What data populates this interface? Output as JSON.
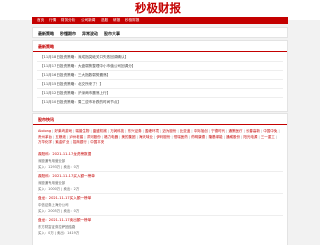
{
  "site": {
    "logo": "秒极财报"
  },
  "nav": {
    "items": [
      "首页",
      "行情",
      "财务分析",
      "公司新闻",
      "选股",
      "研报",
      "秒极财报"
    ]
  },
  "tabs": [
    "最新策略",
    "秒懂期市",
    "异常波动",
    "股市大事"
  ],
  "section2": {
    "title": "最新策略",
    "items": [
      "【11月18日投资策略：深成指突破关口失败回调确认】",
      "【11月17日投资策略：大盘弱势整理中小市值公司回调分】",
      "【11月16日投资策略：三大指数弱势震荡】",
      "【11月15日投资策略：北交所来了！】",
      "【11月12日投资策略：沪深两市震荡上行】",
      "【11月10日投资策略：周二逆市补跌的时间节点】"
    ]
  },
  "section3": {
    "title": "股市快讯",
    "stocks": [
      "Aiolong",
      "好莱坞游戏",
      "瑞普生物",
      "晶盛机械",
      "万润科技",
      "东兴证券",
      "盈峰环境",
      "迈为股份",
      "比亚迪",
      "中际旭创",
      "宁德时代",
      "通策医疗",
      "长春高新",
      "中国中免",
      "贵州茅台",
      "五粮液",
      "泸州老窖",
      "洋河股份",
      "格力电器",
      "美的集团",
      "海天味业",
      "伊利股份",
      "恒瑞医药",
      "药明康德",
      "隆基绿能",
      "通威股份",
      "阳光电源",
      "三一重工",
      "万华化学",
      "紫金矿业",
      "招商银行",
      "中国平安"
    ],
    "posts": [
      {
        "title": "鼎阳科：2021-11-17龙虎榜数据",
        "lines": [
          "深股通专用营业部",
          "买入：1293万 | 卖出：0万"
        ]
      },
      {
        "title": "鼎阳科：2021-11-17买入额一榜单",
        "lines": [
          "深股通专用营业部",
          "买入：1000万 | 卖出：2万"
        ]
      },
      {
        "title": "盘龙：2021-11-17买入额一榜单",
        "lines": [
          "中信证券上海分公司",
          "买入：2005万 | 卖出：0万"
        ]
      },
      {
        "title": "盘龙：2021-11-17卖出额一榜单",
        "lines": [
          "东方财富证券拉萨团结路",
          "买入：0万 | 卖出：1419万"
        ]
      }
    ]
  }
}
